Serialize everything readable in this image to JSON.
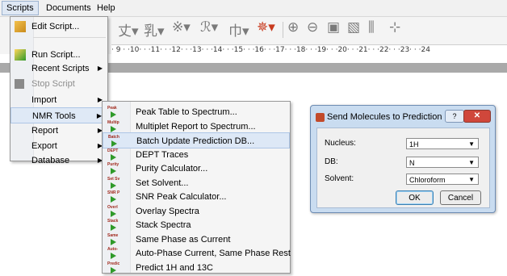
{
  "menubar": {
    "items": [
      "Scripts",
      "Documents",
      "Help"
    ]
  },
  "ruler": {
    "text": "· 9 · ·10· · ·11· · ·12· · ·13· · ·14· · ·15· · ·16· · ·17· · ·18· · ·19· · ·20· · ·21· · ·22· · ·23· · ·24"
  },
  "scripts_menu": {
    "items": [
      {
        "label": "Edit Script...",
        "icon": "edit-script-icon"
      },
      {
        "label": "Run Script...",
        "icon": "run-script-icon"
      },
      {
        "label": "Recent Scripts",
        "submenu": true
      },
      {
        "label": "Stop Script",
        "disabled": true,
        "icon": "stop-icon"
      },
      {
        "label": "Import",
        "submenu": true
      },
      {
        "label": "NMR Tools",
        "submenu": true,
        "highlighted": true
      },
      {
        "label": "Report",
        "submenu": true
      },
      {
        "label": "Export",
        "submenu": true
      },
      {
        "label": "Database",
        "submenu": true
      }
    ]
  },
  "nmr_tools_menu": {
    "items": [
      {
        "tag": "Peak",
        "label": "Peak Table to Spectrum..."
      },
      {
        "tag": "Multip",
        "label": "Multiplet Report to Spectrum..."
      },
      {
        "tag": "Batch",
        "label": "Batch Update Prediction DB...",
        "highlighted": true
      },
      {
        "tag": "DEPT",
        "label": "DEPT Traces"
      },
      {
        "tag": "Purity",
        "label": "Purity Calculator..."
      },
      {
        "tag": "Set Sv",
        "label": "Set Solvent..."
      },
      {
        "tag": "SNR P",
        "label": "SNR Peak Calculator..."
      },
      {
        "tag": "Overl",
        "label": "Overlay Spectra"
      },
      {
        "tag": "Stack",
        "label": "Stack Spectra"
      },
      {
        "tag": "Same",
        "label": "Same Phase as Current"
      },
      {
        "tag": "Auto-",
        "label": "Auto-Phase Current, Same Phase Rest"
      },
      {
        "tag": "Predic",
        "label": "Predict 1H and 13C"
      }
    ]
  },
  "dialog": {
    "title": "Send Molecules to Prediction DB",
    "help": "?",
    "close": "✕",
    "fields": [
      {
        "label": "Nucleus:",
        "value": "1H"
      },
      {
        "label": "DB:",
        "value": "N"
      },
      {
        "label": "Solvent:",
        "value": "Chloroform"
      }
    ],
    "ok": "OK",
    "cancel": "Cancel"
  }
}
